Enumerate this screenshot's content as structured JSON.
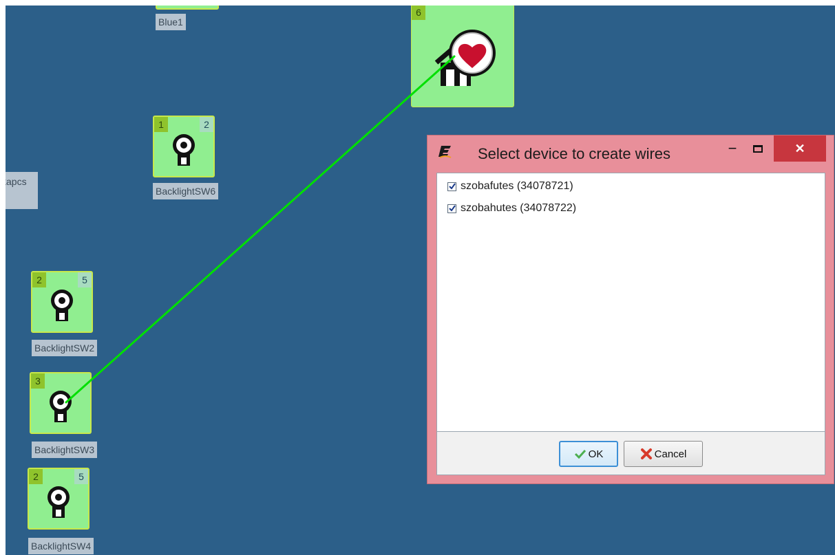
{
  "canvas": {
    "partial_labels": {
      "blue1": "Blue1",
      "kapcs": "kapcs"
    },
    "devices": [
      {
        "id": "hub",
        "left_badge": "6",
        "right_badge": ""
      },
      {
        "id": "sw6",
        "left_badge": "1",
        "right_badge": "2",
        "label": "BacklightSW6"
      },
      {
        "id": "sw2",
        "left_badge": "2",
        "right_badge": "5",
        "label": "BacklightSW2"
      },
      {
        "id": "sw3",
        "left_badge": "3",
        "right_badge": "",
        "label": "BacklightSW3"
      },
      {
        "id": "sw4",
        "left_badge": "2",
        "right_badge": "5",
        "label": "BacklightSW4"
      }
    ],
    "wire_color": "#00e000",
    "background_color": "#2c5f89",
    "device_color": "#90ee90"
  },
  "dialog": {
    "title": "Select device to create wires",
    "icon": "app-logo-icon",
    "items": [
      {
        "label": "szobafutes (34078721)",
        "checked": true
      },
      {
        "label": "szobahutes (34078722)",
        "checked": true
      }
    ],
    "buttons": {
      "ok": "OK",
      "cancel": "Cancel"
    },
    "frame_color": "#e88f9a",
    "close_color": "#c7363e"
  }
}
